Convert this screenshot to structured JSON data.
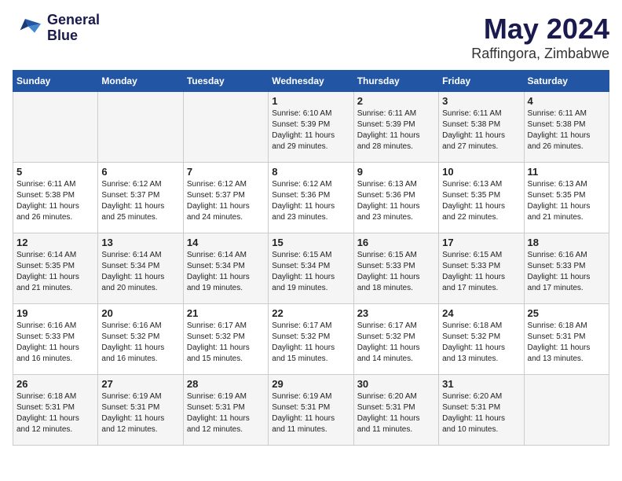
{
  "header": {
    "logo_line1": "General",
    "logo_line2": "Blue",
    "month": "May 2024",
    "location": "Raffingora, Zimbabwe"
  },
  "weekdays": [
    "Sunday",
    "Monday",
    "Tuesday",
    "Wednesday",
    "Thursday",
    "Friday",
    "Saturday"
  ],
  "weeks": [
    [
      {
        "day": "",
        "info": ""
      },
      {
        "day": "",
        "info": ""
      },
      {
        "day": "",
        "info": ""
      },
      {
        "day": "1",
        "info": "Sunrise: 6:10 AM\nSunset: 5:39 PM\nDaylight: 11 hours\nand 29 minutes."
      },
      {
        "day": "2",
        "info": "Sunrise: 6:11 AM\nSunset: 5:39 PM\nDaylight: 11 hours\nand 28 minutes."
      },
      {
        "day": "3",
        "info": "Sunrise: 6:11 AM\nSunset: 5:38 PM\nDaylight: 11 hours\nand 27 minutes."
      },
      {
        "day": "4",
        "info": "Sunrise: 6:11 AM\nSunset: 5:38 PM\nDaylight: 11 hours\nand 26 minutes."
      }
    ],
    [
      {
        "day": "5",
        "info": "Sunrise: 6:11 AM\nSunset: 5:38 PM\nDaylight: 11 hours\nand 26 minutes."
      },
      {
        "day": "6",
        "info": "Sunrise: 6:12 AM\nSunset: 5:37 PM\nDaylight: 11 hours\nand 25 minutes."
      },
      {
        "day": "7",
        "info": "Sunrise: 6:12 AM\nSunset: 5:37 PM\nDaylight: 11 hours\nand 24 minutes."
      },
      {
        "day": "8",
        "info": "Sunrise: 6:12 AM\nSunset: 5:36 PM\nDaylight: 11 hours\nand 23 minutes."
      },
      {
        "day": "9",
        "info": "Sunrise: 6:13 AM\nSunset: 5:36 PM\nDaylight: 11 hours\nand 23 minutes."
      },
      {
        "day": "10",
        "info": "Sunrise: 6:13 AM\nSunset: 5:35 PM\nDaylight: 11 hours\nand 22 minutes."
      },
      {
        "day": "11",
        "info": "Sunrise: 6:13 AM\nSunset: 5:35 PM\nDaylight: 11 hours\nand 21 minutes."
      }
    ],
    [
      {
        "day": "12",
        "info": "Sunrise: 6:14 AM\nSunset: 5:35 PM\nDaylight: 11 hours\nand 21 minutes."
      },
      {
        "day": "13",
        "info": "Sunrise: 6:14 AM\nSunset: 5:34 PM\nDaylight: 11 hours\nand 20 minutes."
      },
      {
        "day": "14",
        "info": "Sunrise: 6:14 AM\nSunset: 5:34 PM\nDaylight: 11 hours\nand 19 minutes."
      },
      {
        "day": "15",
        "info": "Sunrise: 6:15 AM\nSunset: 5:34 PM\nDaylight: 11 hours\nand 19 minutes."
      },
      {
        "day": "16",
        "info": "Sunrise: 6:15 AM\nSunset: 5:33 PM\nDaylight: 11 hours\nand 18 minutes."
      },
      {
        "day": "17",
        "info": "Sunrise: 6:15 AM\nSunset: 5:33 PM\nDaylight: 11 hours\nand 17 minutes."
      },
      {
        "day": "18",
        "info": "Sunrise: 6:16 AM\nSunset: 5:33 PM\nDaylight: 11 hours\nand 17 minutes."
      }
    ],
    [
      {
        "day": "19",
        "info": "Sunrise: 6:16 AM\nSunset: 5:33 PM\nDaylight: 11 hours\nand 16 minutes."
      },
      {
        "day": "20",
        "info": "Sunrise: 6:16 AM\nSunset: 5:32 PM\nDaylight: 11 hours\nand 16 minutes."
      },
      {
        "day": "21",
        "info": "Sunrise: 6:17 AM\nSunset: 5:32 PM\nDaylight: 11 hours\nand 15 minutes."
      },
      {
        "day": "22",
        "info": "Sunrise: 6:17 AM\nSunset: 5:32 PM\nDaylight: 11 hours\nand 15 minutes."
      },
      {
        "day": "23",
        "info": "Sunrise: 6:17 AM\nSunset: 5:32 PM\nDaylight: 11 hours\nand 14 minutes."
      },
      {
        "day": "24",
        "info": "Sunrise: 6:18 AM\nSunset: 5:32 PM\nDaylight: 11 hours\nand 13 minutes."
      },
      {
        "day": "25",
        "info": "Sunrise: 6:18 AM\nSunset: 5:31 PM\nDaylight: 11 hours\nand 13 minutes."
      }
    ],
    [
      {
        "day": "26",
        "info": "Sunrise: 6:18 AM\nSunset: 5:31 PM\nDaylight: 11 hours\nand 12 minutes."
      },
      {
        "day": "27",
        "info": "Sunrise: 6:19 AM\nSunset: 5:31 PM\nDaylight: 11 hours\nand 12 minutes."
      },
      {
        "day": "28",
        "info": "Sunrise: 6:19 AM\nSunset: 5:31 PM\nDaylight: 11 hours\nand 12 minutes."
      },
      {
        "day": "29",
        "info": "Sunrise: 6:19 AM\nSunset: 5:31 PM\nDaylight: 11 hours\nand 11 minutes."
      },
      {
        "day": "30",
        "info": "Sunrise: 6:20 AM\nSunset: 5:31 PM\nDaylight: 11 hours\nand 11 minutes."
      },
      {
        "day": "31",
        "info": "Sunrise: 6:20 AM\nSunset: 5:31 PM\nDaylight: 11 hours\nand 10 minutes."
      },
      {
        "day": "",
        "info": ""
      }
    ]
  ]
}
